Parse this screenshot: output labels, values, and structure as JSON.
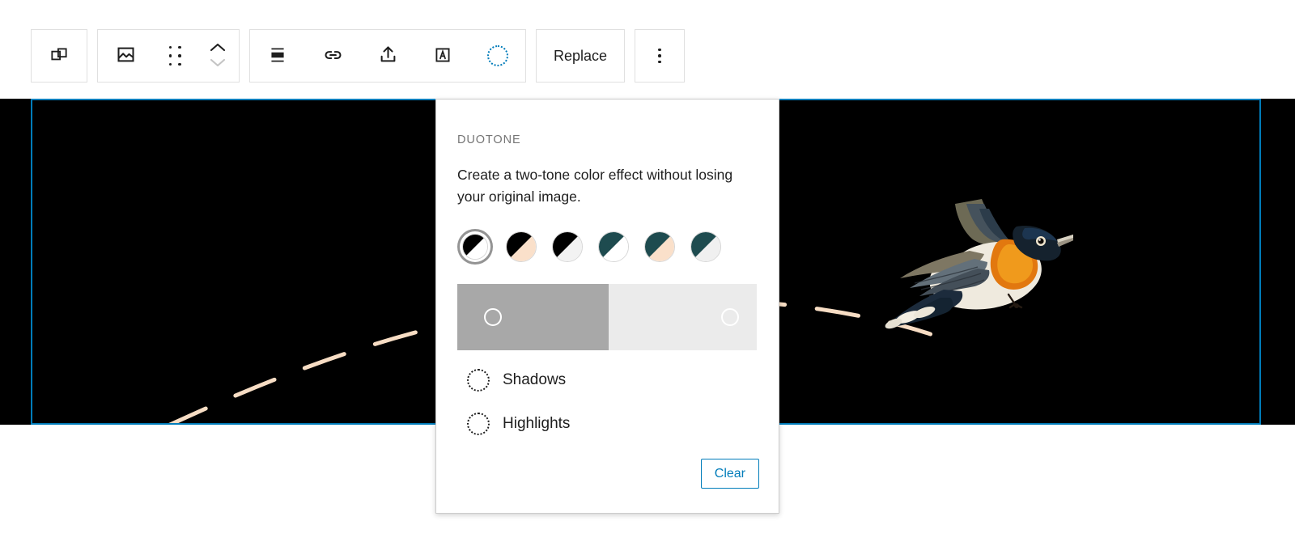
{
  "toolbar": {
    "groups": [
      {
        "name": "parent-block",
        "buttons": [
          {
            "icon": "select-parent-block-icon",
            "label": ""
          }
        ]
      },
      {
        "name": "block-type-and-mover",
        "buttons": [
          {
            "icon": "image-block-icon",
            "label": ""
          },
          {
            "icon": "drag-handle-icon",
            "label": ""
          },
          {
            "icon": "move-up-down-icon",
            "label": ""
          }
        ]
      },
      {
        "name": "block-formatting",
        "buttons": [
          {
            "icon": "align-icon",
            "label": ""
          },
          {
            "icon": "link-icon",
            "label": ""
          },
          {
            "icon": "upload-icon",
            "label": ""
          },
          {
            "icon": "add-text-over-image-icon",
            "label": ""
          },
          {
            "icon": "duotone-filter-icon",
            "label": ""
          }
        ]
      },
      {
        "name": "replace",
        "buttons": [
          {
            "icon": "",
            "label": "Replace"
          }
        ]
      },
      {
        "name": "more-options",
        "buttons": [
          {
            "icon": "more-options-icon",
            "label": ""
          }
        ]
      }
    ],
    "replace_label": "Replace"
  },
  "duotone_panel": {
    "title": "DUOTONE",
    "description": "Create a two-tone color effect without losing your original image.",
    "presets": [
      {
        "name": "grayscale",
        "shadow": "#000000",
        "highlight": "#ffffff",
        "selected": true
      },
      {
        "name": "black-peach",
        "shadow": "#000000",
        "highlight": "#fae0ca",
        "selected": false
      },
      {
        "name": "black-white-smoke",
        "shadow": "#000000",
        "highlight": "#f2f2f2",
        "selected": false
      },
      {
        "name": "teal-white",
        "shadow": "#1e4b4f",
        "highlight": "#ffffff",
        "selected": false
      },
      {
        "name": "teal-peach",
        "shadow": "#1e4b4f",
        "highlight": "#fae0ca",
        "selected": false
      },
      {
        "name": "teal-white-smoke",
        "shadow": "#1e4b4f",
        "highlight": "#f0f0f0",
        "selected": false
      }
    ],
    "slider": {
      "left_color": "#a8a8a8",
      "right_color": "#ebebeb",
      "shadow_knob_pct": 12,
      "highlight_knob_pct": 91
    },
    "color_rows": [
      {
        "name": "shadows",
        "label": "Shadows",
        "value": ""
      },
      {
        "name": "highlights",
        "label": "Highlights",
        "value": ""
      }
    ],
    "clear_label": "Clear"
  },
  "canvas": {
    "background": "#000000",
    "selection_color": "#007cba",
    "curve_color": "#f7ddc4",
    "image_alt": "flying-swallow-bird-illustration"
  },
  "colors": {
    "accent": "#007cba",
    "text": "#1e1e1e",
    "muted": "#757575",
    "border": "#e0e0e0"
  }
}
